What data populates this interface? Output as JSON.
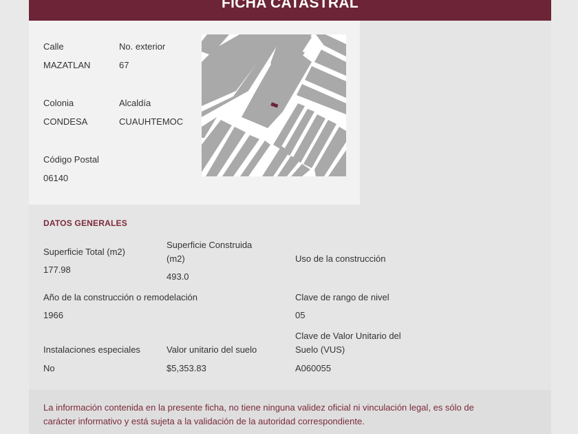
{
  "header": {
    "title": "FICHA CATASTRAL"
  },
  "location": {
    "calle_label": "Calle",
    "calle_value": "MAZATLAN",
    "num_label": "No. exterior",
    "num_value": "67",
    "colonia_label": "Colonia",
    "colonia_value": "CONDESA",
    "alcaldia_label": "Alcaldía",
    "alcaldia_value": "CUAUHTEMOC",
    "cp_label": "Código Postal",
    "cp_value": "06140"
  },
  "map": {
    "marker_color": "#6c2436",
    "block_color": "#a9a9a9"
  },
  "datos": {
    "title": "DATOS GENERALES",
    "sup_total_label": "Superficie Total (m2)",
    "sup_total_value": "177.98",
    "sup_const_label_1": "Superficie Construida",
    "sup_const_label_2": "(m2)",
    "sup_const_value": "493.0",
    "uso_label": "Uso de la construcción",
    "anio_label": "Año de la construcción o remodelación",
    "anio_value": "1966",
    "rango_label": "Clave de rango de nivel",
    "rango_value": "05",
    "inst_label": "Instalaciones especiales",
    "inst_value": "No",
    "valor_label": "Valor unitario del suelo",
    "valor_value": "$5,353.83",
    "vus_label_1": "Clave de Valor Unitario del",
    "vus_label_2": "Suelo (VUS)",
    "vus_value": "A060055"
  },
  "disclaimer": {
    "line1": "La información contenida en la presente ficha, no tiene ninguna validez oficial ni vinculación legal, es sólo de",
    "line2": "carácter informativo y está sujeta a la validación de la autoridad correspondiente."
  },
  "colors": {
    "accent": "#6c2436",
    "accent_text": "#7a2a3c"
  }
}
